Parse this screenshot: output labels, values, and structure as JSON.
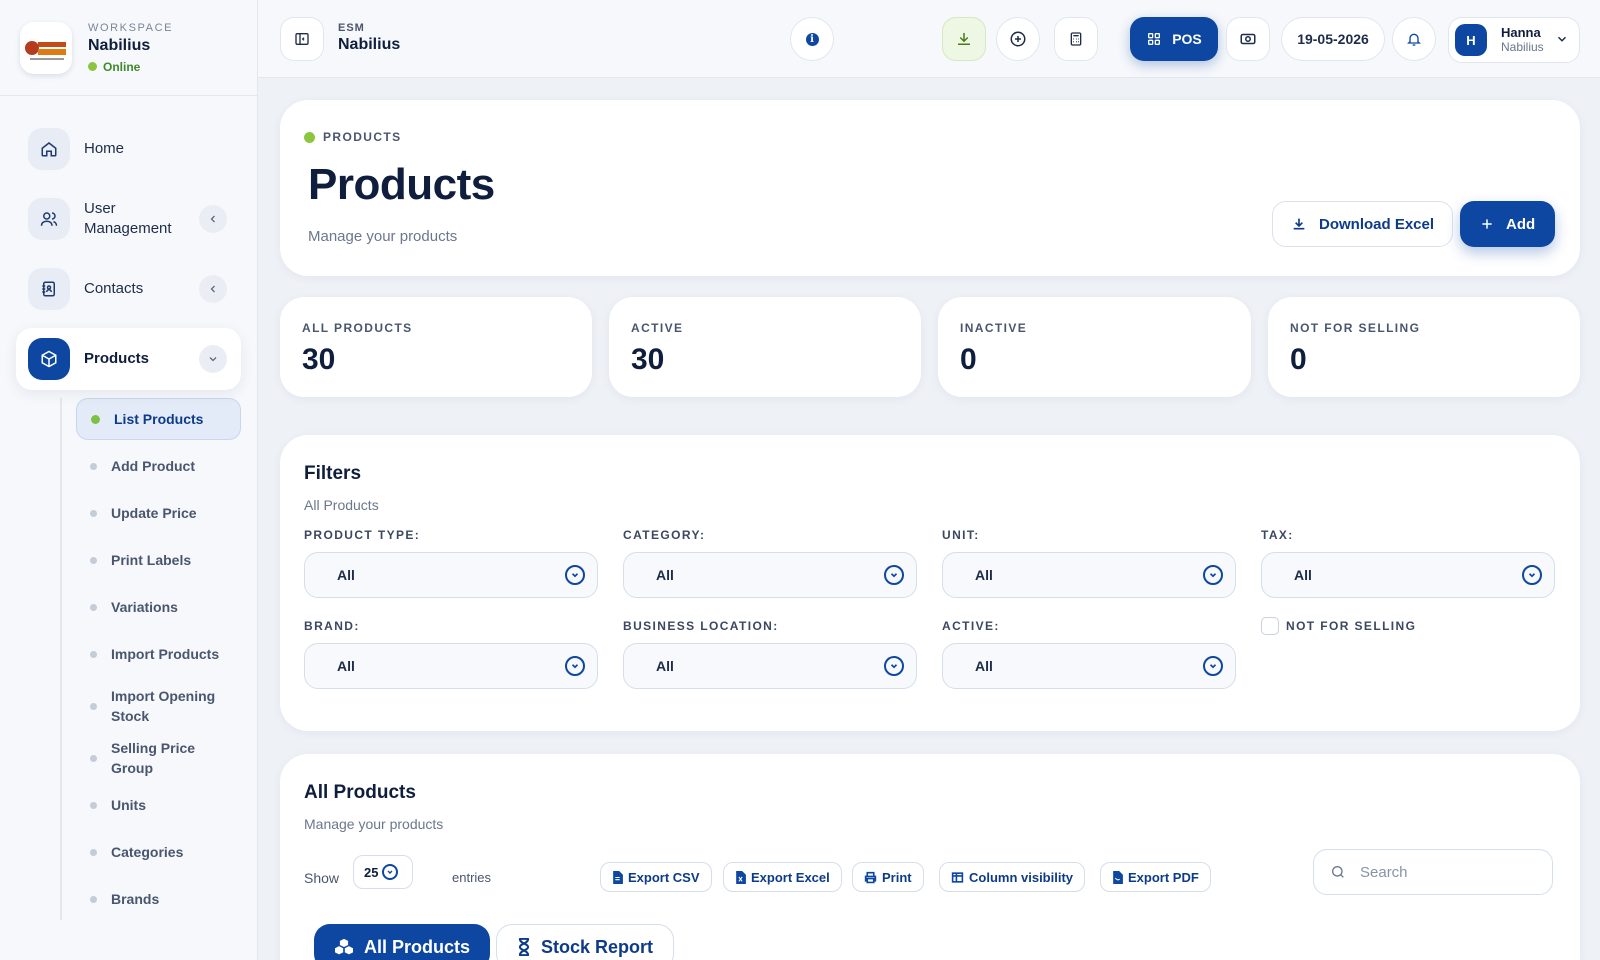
{
  "workspace": {
    "label": "WORKSPACE",
    "name": "Nabilius",
    "status": "Online"
  },
  "sidebar": {
    "items": [
      {
        "label": "Home",
        "icon": "home-icon"
      },
      {
        "label": "User Management",
        "icon": "users-icon"
      },
      {
        "label": "Contacts",
        "icon": "contacts-icon"
      },
      {
        "label": "Products",
        "icon": "box-icon"
      }
    ],
    "submenu": [
      "List Products",
      "Add Product",
      "Update Price",
      "Print Labels",
      "Variations",
      "Import Products",
      "Import Opening Stock",
      "Selling Price Group",
      "Units",
      "Categories",
      "Brands"
    ]
  },
  "topbar": {
    "section": "ESM",
    "name": "Nabilius",
    "pos_label": "POS",
    "date": "19-05-2026",
    "user_initial": "H",
    "user_name": "Hanna",
    "user_org": "Nabilius"
  },
  "header": {
    "eyebrow": "PRODUCTS",
    "title": "Products",
    "subtitle": "Manage your products",
    "download_label": "Download Excel",
    "add_label": "Add"
  },
  "stats": [
    {
      "label": "ALL PRODUCTS",
      "value": "30"
    },
    {
      "label": "ACTIVE",
      "value": "30"
    },
    {
      "label": "INACTIVE",
      "value": "0"
    },
    {
      "label": "NOT FOR SELLING",
      "value": "0"
    }
  ],
  "filters": {
    "title": "Filters",
    "subtitle": "All Products",
    "fields": [
      {
        "label": "PRODUCT TYPE:",
        "value": "All"
      },
      {
        "label": "CATEGORY:",
        "value": "All"
      },
      {
        "label": "UNIT:",
        "value": "All"
      },
      {
        "label": "TAX:",
        "value": "All"
      },
      {
        "label": "BRAND:",
        "value": "All"
      },
      {
        "label": "BUSINESS LOCATION:",
        "value": "All"
      },
      {
        "label": "ACTIVE:",
        "value": "All"
      }
    ],
    "not_for_selling": "NOT FOR SELLING"
  },
  "table": {
    "title": "All Products",
    "subtitle": "Manage your products",
    "show_label": "Show",
    "entries_value": "25",
    "entries_label": "entries",
    "buttons": [
      "Export CSV",
      "Export Excel",
      "Print",
      "Column visibility",
      "Export PDF"
    ],
    "search_placeholder": "Search",
    "tabs": [
      "All Products",
      "Stock Report"
    ]
  },
  "colors": {
    "primary": "#0d47a1",
    "accent_green": "#8cc63f",
    "background": "#eef1f6"
  }
}
